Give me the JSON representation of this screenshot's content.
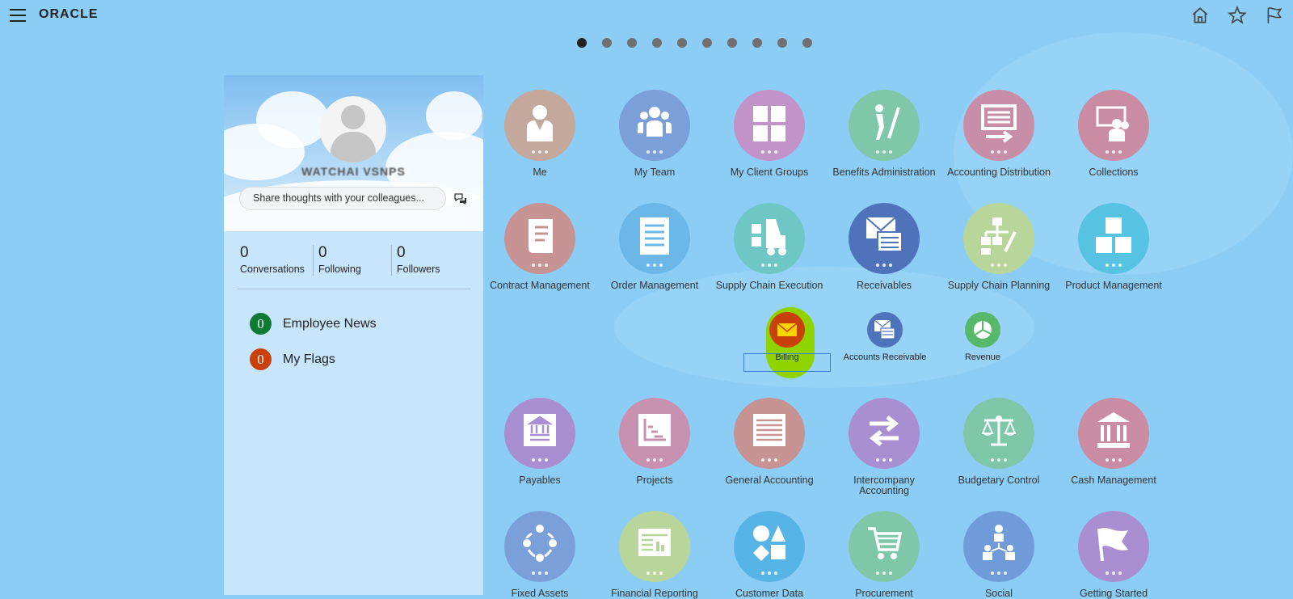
{
  "topbar": {
    "logo": "ORACLE",
    "icons": [
      "home-icon",
      "star-icon",
      "flag-icon"
    ]
  },
  "pagination": {
    "count": 10,
    "active": 0
  },
  "profile": {
    "username": "WATCHAI VSNPS",
    "share_placeholder": "Share thoughts with your colleagues...",
    "stats": [
      {
        "value": "0",
        "label": "Conversations"
      },
      {
        "value": "0",
        "label": "Following"
      },
      {
        "value": "0",
        "label": "Followers"
      }
    ],
    "news": [
      {
        "count": "0",
        "label": "Employee News",
        "color": "#0e7a34"
      },
      {
        "count": "0",
        "label": "My Flags",
        "color": "#c9400b"
      }
    ]
  },
  "tiles": {
    "row1": [
      {
        "label": "Me",
        "color": "#c4a89b",
        "icon": "person-icon"
      },
      {
        "label": "My Team",
        "color": "#7a9fd9",
        "icon": "team-icon"
      },
      {
        "label": "My Client Groups",
        "color": "#c293c9",
        "icon": "groups-icon"
      },
      {
        "label": "Benefits Administration",
        "color": "#7fc7a9",
        "icon": "golfer-icon"
      },
      {
        "label": "Accounting Distribution",
        "color": "#c88ea8",
        "icon": "distribution-icon"
      },
      {
        "label": "Collections",
        "color": "#c98ca3",
        "icon": "collections-icon"
      }
    ],
    "row2": [
      {
        "label": "Contract Management",
        "color": "#c89393",
        "icon": "contract-icon"
      },
      {
        "label": "Order Management",
        "color": "#6bb8e8",
        "icon": "order-icon"
      },
      {
        "label": "Supply Chain Execution",
        "color": "#6ec7c4",
        "icon": "forklift-icon"
      },
      {
        "label": "Receivables",
        "color": "#4f73bb",
        "icon": "receivables-icon"
      },
      {
        "label": "Supply Chain Planning",
        "color": "#b8d69a",
        "icon": "planning-icon"
      },
      {
        "label": "Product Management",
        "color": "#56c3e2",
        "icon": "boxes-icon"
      }
    ],
    "row3": [
      {
        "label": "Payables",
        "color": "#a98fd1",
        "icon": "payables-icon"
      },
      {
        "label": "Projects",
        "color": "#c991b0",
        "icon": "projects-icon"
      },
      {
        "label": "General Accounting",
        "color": "#c89393",
        "icon": "ledger-icon"
      },
      {
        "label": "Intercompany Accounting",
        "color": "#a88fd1",
        "icon": "transfer-icon"
      },
      {
        "label": "Budgetary Control",
        "color": "#7fc7a9",
        "icon": "scales-icon"
      },
      {
        "label": "Cash Management",
        "color": "#c98ca3",
        "icon": "bank-icon"
      }
    ],
    "row4": [
      {
        "label": "Fixed Assets",
        "color": "#7a9fd9",
        "icon": "cycle-icon"
      },
      {
        "label": "Financial Reporting",
        "color": "#b8d69a",
        "icon": "report-icon"
      },
      {
        "label": "Customer Data",
        "color": "#56b4e6",
        "icon": "shapes-icon"
      },
      {
        "label": "Procurement",
        "color": "#7fc7a9",
        "icon": "cart-icon"
      },
      {
        "label": "Social",
        "color": "#6f9bd8",
        "icon": "social-icon"
      },
      {
        "label": "Getting Started",
        "color": "#a98fd1",
        "icon": "flag-icon"
      }
    ]
  },
  "subtiles": [
    {
      "label": "Billing",
      "color": "#c9400b",
      "icon": "envelope-icon"
    },
    {
      "label": "Accounts Receivable",
      "color": "#4f73bb",
      "icon": "receivables-icon"
    },
    {
      "label": "Revenue",
      "color": "#58b869",
      "icon": "pie-icon"
    }
  ]
}
